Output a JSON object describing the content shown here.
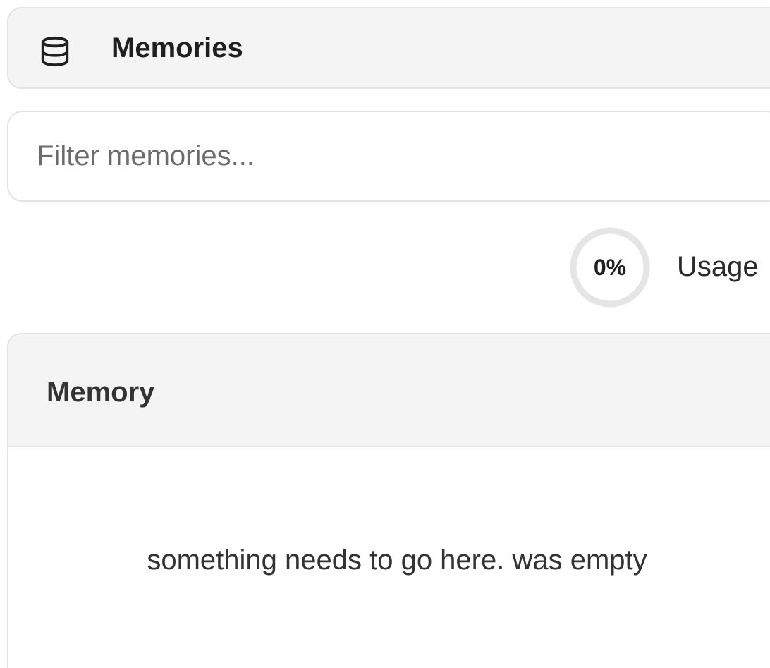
{
  "header": {
    "icon": "database-icon",
    "title": "Memories"
  },
  "filter": {
    "placeholder": "Filter memories...",
    "value": ""
  },
  "usage": {
    "percent_text": "0%",
    "percent_value": 0,
    "label": "Usage",
    "ring_color": "#e5e5e5",
    "fill_color": "#3b82f6"
  },
  "table": {
    "column_header": "Memory",
    "empty_message": "something needs to go here. was empty"
  }
}
